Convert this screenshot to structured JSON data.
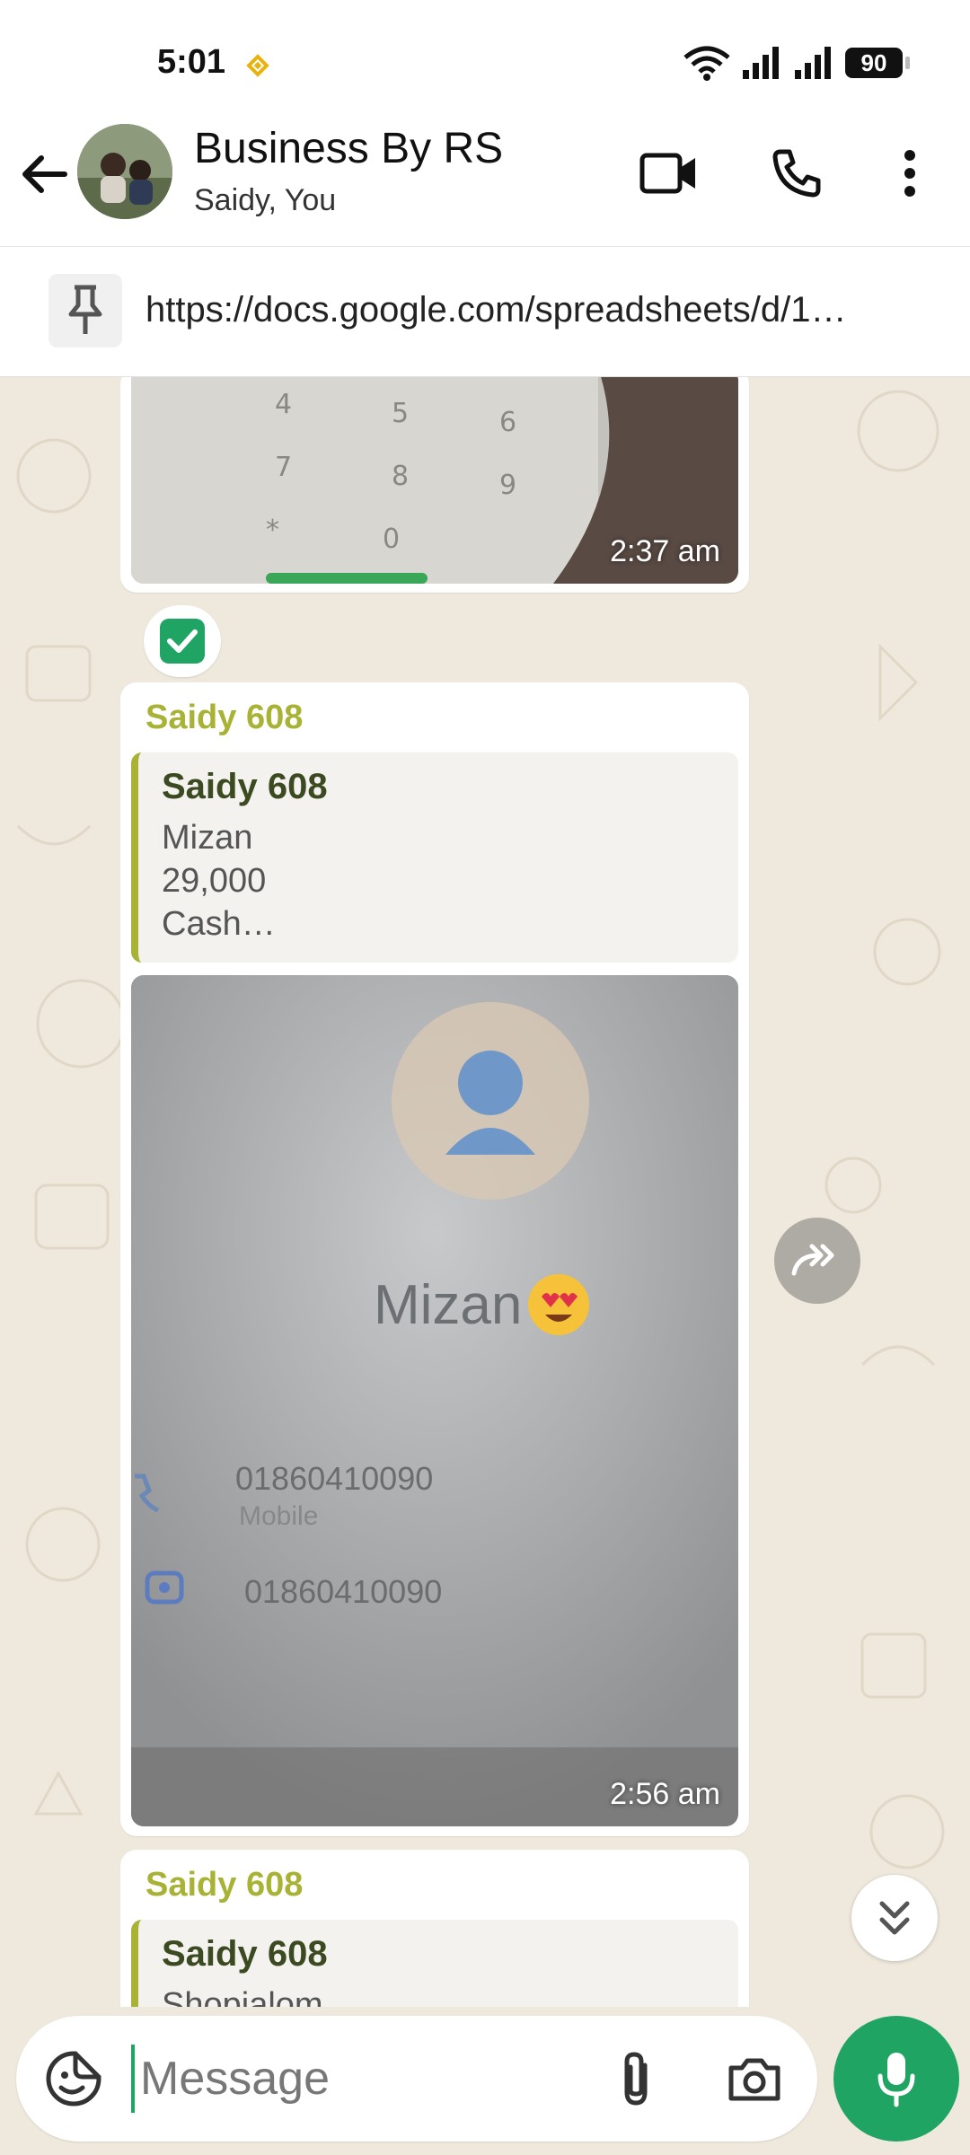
{
  "status_bar": {
    "time": "5:01",
    "battery": "90"
  },
  "header": {
    "title": "Business By RS",
    "subtitle": "Saidy, You"
  },
  "pinned": {
    "text": "https://docs.google.com/spreadsheets/d/1…"
  },
  "messages": [
    {
      "type": "image",
      "time": "2:37 am"
    },
    {
      "type": "image-reply",
      "sender": "Saidy 608",
      "quote": {
        "name": "Saidy 608",
        "lines": [
          "Mizan",
          "29,000",
          "Cash…"
        ]
      },
      "image_text": {
        "contact_name": "Mizan",
        "number_1": "01860410090",
        "label_1": "Mobile",
        "number_2": "01860410090"
      },
      "time": "2:56 am"
    },
    {
      "type": "image-reply",
      "sender": "Saidy 608",
      "quote": {
        "name": "Saidy 608",
        "lines": [
          "Shopialom"
        ]
      }
    }
  ],
  "input": {
    "placeholder": "Message"
  },
  "colors": {
    "accent": "#1fa463",
    "sender": "#a8b335",
    "chat_bg": "#efe8dc"
  },
  "icons": [
    "back-arrow-icon",
    "video-call-icon",
    "phone-icon",
    "more-vert-icon",
    "pin-icon",
    "check-icon",
    "forward-icon",
    "scroll-down-icon",
    "sticker-icon",
    "attach-icon",
    "camera-icon",
    "mic-icon"
  ]
}
